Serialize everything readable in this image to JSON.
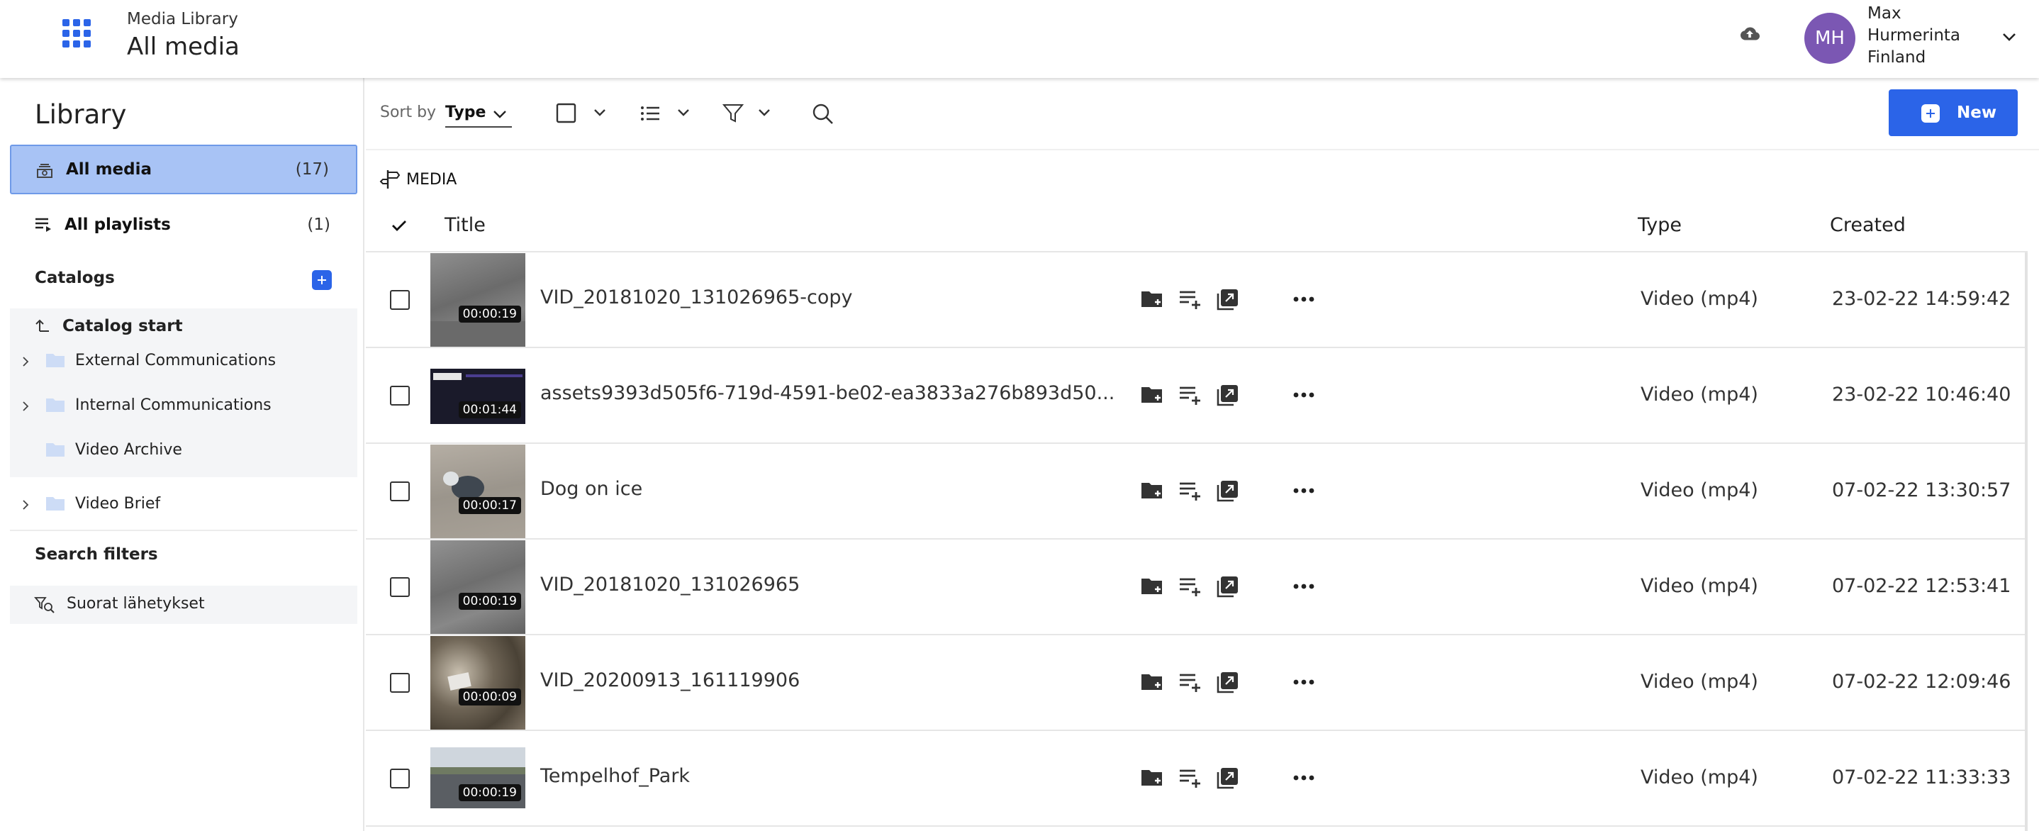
{
  "header": {
    "app_subtitle": "Media Library",
    "page_title": "All media",
    "user_initials": "MH",
    "user_line1": "Max",
    "user_line2": "Hurmerinta",
    "user_line3": "Finland",
    "avatar_color": "#7b57b3"
  },
  "sidebar": {
    "title": "Library",
    "all_media_label": "All media",
    "all_media_count": "(17)",
    "all_playlists_label": "All playlists",
    "all_playlists_count": "(1)",
    "catalogs_title": "Catalogs",
    "catalog_start": "Catalog start",
    "catalogs": [
      {
        "label": "External Communications",
        "expandable": true
      },
      {
        "label": "Internal Communications",
        "expandable": true
      },
      {
        "label": "Video Archive",
        "expandable": false
      },
      {
        "label": "Video Brief",
        "expandable": true
      }
    ],
    "search_filters_title": "Search filters",
    "search_filter_item": "Suorat lähetykset"
  },
  "toolbar": {
    "sort_by_label": "Sort by",
    "sort_value": "Type",
    "new_label": "New"
  },
  "breadcrumb": {
    "label": "MEDIA"
  },
  "table": {
    "col_title": "Title",
    "col_type": "Type",
    "col_created": "Created",
    "rows": [
      {
        "title": "VID_20181020_131026965-copy",
        "duration": "00:00:19",
        "type": "Video (mp4)",
        "created": "23-02-22 14:59:42"
      },
      {
        "title": "assets9393d505f6-719d-4591-be02-ea3833a276b893d50...",
        "duration": "00:01:44",
        "type": "Video (mp4)",
        "created": "23-02-22 10:46:40"
      },
      {
        "title": "Dog on ice",
        "duration": "00:00:17",
        "type": "Video (mp4)",
        "created": "07-02-22 13:30:57"
      },
      {
        "title": "VID_20181020_131026965",
        "duration": "00:00:19",
        "type": "Video (mp4)",
        "created": "07-02-22 12:53:41"
      },
      {
        "title": "VID_20200913_161119906",
        "duration": "00:00:09",
        "type": "Video (mp4)",
        "created": "07-02-22 12:09:46"
      },
      {
        "title": "Tempelhof_Park",
        "duration": "00:00:19",
        "type": "Video (mp4)",
        "created": "07-02-22 11:33:33"
      }
    ]
  },
  "colors": {
    "accent": "#2b64e8",
    "active_nav_bg": "#a8c3f5",
    "panel_bg": "#f4f5f7"
  },
  "icons": {
    "apps": "apps-grid-icon",
    "upload": "cloud-upload-icon",
    "row_actions": [
      "add-to-folder-icon",
      "add-to-playlist-icon",
      "share-icon",
      "more-icon"
    ]
  }
}
